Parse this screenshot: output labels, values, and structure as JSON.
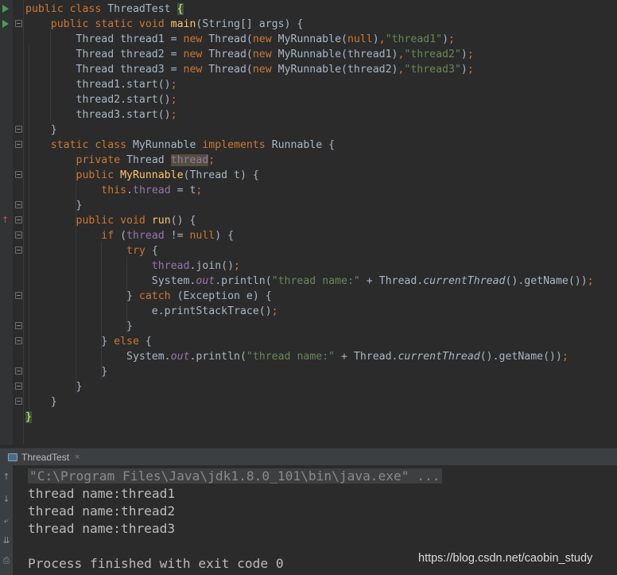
{
  "editor": {
    "file_class": "ThreadTest",
    "lines": [
      [
        {
          "t": "public class ",
          "c": "kw"
        },
        {
          "t": "ThreadTest "
        },
        {
          "t": "{",
          "c": "brace-hl"
        }
      ],
      [
        {
          "t": "    "
        },
        {
          "t": "public static void ",
          "c": "kw"
        },
        {
          "t": "main",
          "c": "fn"
        },
        {
          "t": "(String[] args) {"
        }
      ],
      [
        {
          "t": "        Thread thread1 = "
        },
        {
          "t": "new ",
          "c": "kw"
        },
        {
          "t": "Thread("
        },
        {
          "t": "new ",
          "c": "kw"
        },
        {
          "t": "MyRunnable("
        },
        {
          "t": "null",
          "c": "kw"
        },
        {
          "t": ")"
        },
        {
          "t": ",",
          "c": "kw"
        },
        {
          "t": "\"thread1\"",
          "c": "str"
        },
        {
          "t": ")"
        },
        {
          "t": ";",
          "c": "kw"
        }
      ],
      [
        {
          "t": "        Thread thread2 = "
        },
        {
          "t": "new ",
          "c": "kw"
        },
        {
          "t": "Thread("
        },
        {
          "t": "new ",
          "c": "kw"
        },
        {
          "t": "MyRunnable(thread1)"
        },
        {
          "t": ",",
          "c": "kw"
        },
        {
          "t": "\"thread2\"",
          "c": "str"
        },
        {
          "t": ")"
        },
        {
          "t": ";",
          "c": "kw"
        }
      ],
      [
        {
          "t": "        Thread thread3 = "
        },
        {
          "t": "new ",
          "c": "kw"
        },
        {
          "t": "Thread("
        },
        {
          "t": "new ",
          "c": "kw"
        },
        {
          "t": "MyRunnable(thread2)"
        },
        {
          "t": ",",
          "c": "kw"
        },
        {
          "t": "\"thread3\"",
          "c": "str"
        },
        {
          "t": ")"
        },
        {
          "t": ";",
          "c": "kw"
        }
      ],
      [
        {
          "t": "        thread1.start()"
        },
        {
          "t": ";",
          "c": "kw"
        }
      ],
      [
        {
          "t": "        thread2.start()"
        },
        {
          "t": ";",
          "c": "kw"
        }
      ],
      [
        {
          "t": "        thread3.start()"
        },
        {
          "t": ";",
          "c": "kw"
        }
      ],
      [
        {
          "t": "    }"
        }
      ],
      [
        {
          "t": "    "
        },
        {
          "t": "static class ",
          "c": "kw"
        },
        {
          "t": "MyRunnable "
        },
        {
          "t": "implements ",
          "c": "kw"
        },
        {
          "t": "Runnable {"
        }
      ],
      [
        {
          "t": "        "
        },
        {
          "t": "private ",
          "c": "kw"
        },
        {
          "t": "Thread "
        },
        {
          "t": "thread",
          "c": "fld hl-field"
        },
        {
          "t": ";",
          "c": "kw"
        }
      ],
      [
        {
          "t": "        "
        },
        {
          "t": "public ",
          "c": "kw"
        },
        {
          "t": "MyRunnable",
          "c": "fn"
        },
        {
          "t": "(Thread t) {"
        }
      ],
      [
        {
          "t": "            "
        },
        {
          "t": "this",
          "c": "kw"
        },
        {
          "t": "."
        },
        {
          "t": "thread",
          "c": "fld"
        },
        {
          "t": " = t"
        },
        {
          "t": ";",
          "c": "kw"
        }
      ],
      [
        {
          "t": "        }"
        }
      ],
      [
        {
          "t": "        "
        },
        {
          "t": "public void ",
          "c": "kw"
        },
        {
          "t": "run",
          "c": "fn"
        },
        {
          "t": "() {"
        }
      ],
      [
        {
          "t": "            "
        },
        {
          "t": "if ",
          "c": "kw"
        },
        {
          "t": "("
        },
        {
          "t": "thread",
          "c": "fld"
        },
        {
          "t": " != "
        },
        {
          "t": "null",
          "c": "kw"
        },
        {
          "t": ") {"
        }
      ],
      [
        {
          "t": "                "
        },
        {
          "t": "try ",
          "c": "kw"
        },
        {
          "t": "{"
        }
      ],
      [
        {
          "t": "                    "
        },
        {
          "t": "thread",
          "c": "fld"
        },
        {
          "t": ".join()"
        },
        {
          "t": ";",
          "c": "kw"
        }
      ],
      [
        {
          "t": "                    System."
        },
        {
          "t": "out",
          "c": "fld ital"
        },
        {
          "t": ".println("
        },
        {
          "t": "\"thread name:\"",
          "c": "str"
        },
        {
          "t": " + Thread."
        },
        {
          "t": "currentThread",
          "c": "ital"
        },
        {
          "t": "().getName())"
        },
        {
          "t": ";",
          "c": "kw"
        }
      ],
      [
        {
          "t": "                } "
        },
        {
          "t": "catch ",
          "c": "kw"
        },
        {
          "t": "(Exception e) {"
        }
      ],
      [
        {
          "t": "                    e.printStackTrace()"
        },
        {
          "t": ";",
          "c": "kw"
        }
      ],
      [
        {
          "t": "                }"
        }
      ],
      [
        {
          "t": "            } "
        },
        {
          "t": "else ",
          "c": "kw"
        },
        {
          "t": "{"
        }
      ],
      [
        {
          "t": "                System."
        },
        {
          "t": "out",
          "c": "fld ital"
        },
        {
          "t": ".println("
        },
        {
          "t": "\"thread name:\"",
          "c": "str"
        },
        {
          "t": " + Thread."
        },
        {
          "t": "currentThread",
          "c": "ital"
        },
        {
          "t": "().getName())"
        },
        {
          "t": ";",
          "c": "kw"
        }
      ],
      [
        {
          "t": "            }"
        }
      ],
      [
        {
          "t": "        }"
        }
      ],
      [
        {
          "t": "    }"
        }
      ],
      [
        {
          "t": "}",
          "c": "brace-hl"
        }
      ]
    ]
  },
  "run_panel": {
    "tab_label": "ThreadTest",
    "tab_close": "×",
    "toolbar_icons": [
      "arrow-up-icon",
      "arrow-down-icon",
      "soft-wrap-icon",
      "scroll-to-end-icon",
      "print-icon"
    ],
    "console": {
      "command": "\"C:\\Program Files\\Java\\jdk1.8.0_101\\bin\\java.exe\" ...",
      "output": [
        "thread name:thread1",
        "thread name:thread2",
        "thread name:thread3",
        "",
        "Process finished with exit code 0"
      ]
    }
  },
  "watermark": "https://blog.csdn.net/caobin_study"
}
